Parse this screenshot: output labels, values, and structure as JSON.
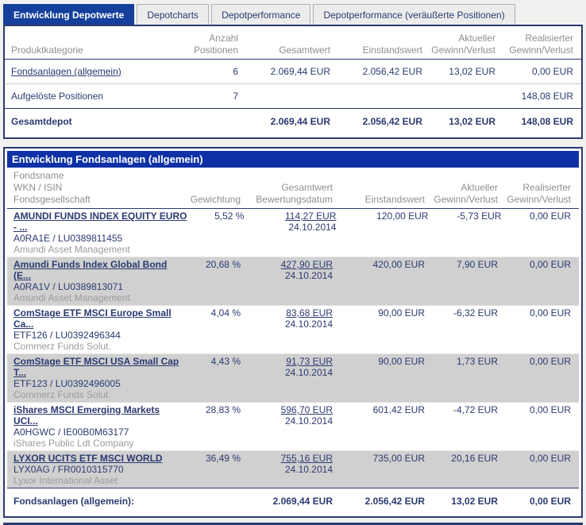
{
  "colors": {
    "tab_active_bg": "#14409c",
    "section_bar_bg": "#0e31a6",
    "panel_border": "#2b3a70",
    "text_navy": "#2b3a70",
    "header_gray": "#8f8f8f",
    "row_shaded_bg": "#d0d0d0",
    "page_bg": "#f1f1f0"
  },
  "tabs": [
    {
      "label": "Entwicklung Depotwerte",
      "active": true
    },
    {
      "label": "Depotcharts",
      "active": false
    },
    {
      "label": "Depotperformance",
      "active": false
    },
    {
      "label": "Depotperformance (veräußerte Positionen)",
      "active": false
    }
  ],
  "summary_table": {
    "headers": {
      "col1": "Produktkategorie",
      "col2": [
        "Anzahl",
        "Positionen"
      ],
      "col3": [
        "Gesamtwert"
      ],
      "col4": [
        "Einstandswert"
      ],
      "col5": [
        "Aktueller",
        "Gewinn/Verlust"
      ],
      "col6": [
        "Realisierter",
        "Gewinn/Verlust"
      ]
    },
    "rows": [
      {
        "category": "Fondsanlagen (allgemein)",
        "positions": "6",
        "total": "2.069,44 EUR",
        "cost": "2.056,42 EUR",
        "current": "13,02 EUR",
        "realized": "0,00 EUR"
      },
      {
        "category": "Aufgelöste Positionen",
        "positions": "7",
        "total": "",
        "cost": "",
        "current": "",
        "realized": "148,08 EUR"
      }
    ],
    "footer": {
      "label": "Gesamtdepot",
      "positions": "",
      "total": "2.069,44 EUR",
      "cost": "2.056,42 EUR",
      "current": "13,02 EUR",
      "realized": "148,08 EUR"
    }
  },
  "funds_section": {
    "title": "Entwicklung Fondsanlagen (allgemein)",
    "headers": {
      "col1": [
        "Fondsname",
        "WKN / ISIN",
        "Fondsgesellschaft"
      ],
      "col2": [
        "Gewichtung"
      ],
      "col3": [
        "Gesamtwert",
        "Bewertungsdatum"
      ],
      "col4": [
        "Einstandswert"
      ],
      "col5": [
        "Aktueller",
        "Gewinn/Verlust"
      ],
      "col6": [
        "Realisierter",
        "Gewinn/Verlust"
      ]
    },
    "rows": [
      {
        "name1": "AMUNDI FUNDS INDEX EQUITY EURO",
        "name2": "- ...",
        "wkn": "A0RA1E / LU0389811455",
        "company": "Amundi Asset Management",
        "weight": "5,52 %",
        "value": "114,27 EUR",
        "date": "24.10.2014",
        "cost": "120,00 EUR",
        "current": "-5,73 EUR",
        "realized": "0,00 EUR",
        "shaded": false
      },
      {
        "name1": "Amundi Funds Index Global Bond",
        "name2": "(E...",
        "wkn": "A0RA1V / LU0389813071",
        "company": "Amundi Asset Management",
        "weight": "20,68 %",
        "value": "427,90 EUR",
        "date": "24.10.2014",
        "cost": "420,00 EUR",
        "current": "7,90 EUR",
        "realized": "0,00 EUR",
        "shaded": true
      },
      {
        "name1": "ComStage ETF MSCI Europe Small",
        "name2": "Ca...",
        "wkn": "ETF126 / LU0392496344",
        "company": "Commerz Funds Solut.",
        "weight": "4,04 %",
        "value": "83,68 EUR",
        "date": "24.10.2014",
        "cost": "90,00 EUR",
        "current": "-6,32 EUR",
        "realized": "0,00 EUR",
        "shaded": false
      },
      {
        "name1": "ComStage ETF MSCI USA Small Cap",
        "name2": "T...",
        "wkn": "ETF123 / LU0392496005",
        "company": "Commerz Funds Solut.",
        "weight": "4,43 %",
        "value": "91,73 EUR",
        "date": "24.10.2014",
        "cost": "90,00 EUR",
        "current": "1,73 EUR",
        "realized": "0,00 EUR",
        "shaded": true
      },
      {
        "name1": "iShares MSCI Emerging Markets",
        "name2": "UCI...",
        "wkn": "A0HGWC / IE00B0M63177",
        "company": "iShares Public Ldt Company",
        "weight": "28,83 %",
        "value": "596,70 EUR",
        "date": "24.10.2014",
        "cost": "601,42 EUR",
        "current": "-4,72 EUR",
        "realized": "0,00 EUR",
        "shaded": false
      },
      {
        "name1": "LYXOR UCITS ETF MSCI WORLD",
        "name2": "",
        "wkn": "LYX0AG / FR0010315770",
        "company": "Lyxor International Asset",
        "weight": "36,49 %",
        "value": "755,16 EUR",
        "date": "24.10.2014",
        "cost": "735,00 EUR",
        "current": "20,16 EUR",
        "realized": "0,00 EUR",
        "shaded": true
      }
    ],
    "footer": {
      "label": "Fondsanlagen (allgemein):",
      "total": "2.069,44 EUR",
      "cost": "2.056,42 EUR",
      "current": "13,02 EUR",
      "realized": "0,00 EUR"
    }
  }
}
